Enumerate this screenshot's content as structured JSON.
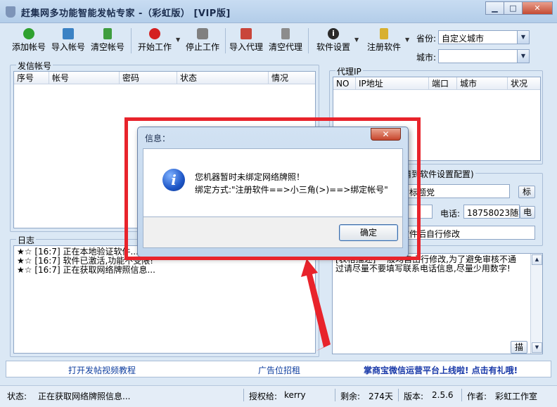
{
  "window": {
    "title": "赶集网多功能智能发帖专家 -（彩虹版） [VIP版]",
    "min_glyph": "▁",
    "max_glyph": "□",
    "close_glyph": "✕"
  },
  "toolbar": {
    "add_account": "添加帐号",
    "import_account": "导入帐号",
    "clear_account": "清空帐号",
    "start_work": "开始工作",
    "stop_work": "停止工作",
    "import_proxy": "导入代理",
    "clear_proxy": "清空代理",
    "software_settings": "软件设置",
    "register_software": "注册软件"
  },
  "location": {
    "province_label": "省份:",
    "province_value": "自定义城市",
    "city_label": "城市:",
    "city_value": ""
  },
  "accounts": {
    "group_title": "发信帐号",
    "columns": [
      "序号",
      "帐号",
      "密码",
      "状态",
      "情况"
    ]
  },
  "proxy": {
    "group_title": "代理IP",
    "columns": [
      "NO",
      "IP地址",
      "端口",
      "城市",
      "状况"
    ]
  },
  "settings": {
    "group_title": "请到软件设置配置)",
    "topic_text": "的标题党",
    "topic_btn": "标",
    "phone_label": "电话:",
    "phone_value": "18758023",
    "phone_random": "随机",
    "phone_btn": "电",
    "note": "软件后自行修改"
  },
  "content": {
    "text": "[表格描述] 一般均自由行修改,为了避免审核不通过请尽量不要填写联系电话信息,尽量少用数字!",
    "btn": "描"
  },
  "log": {
    "group_title": "日志",
    "lines": [
      "★☆ [16:7] 正在本地验证软件...",
      "★☆ [16:7] 软件已激活,功能不受限!",
      "★☆ [16:7] 正在获取网络牌照信息..."
    ]
  },
  "links": {
    "video": "打开发帖视频教程",
    "ad": "广告位招租",
    "promo": "掌商宝微信运营平台上线啦! 点击有礼哦!"
  },
  "status": {
    "state_label": "状态:",
    "state_value": "正在获取网络牌照信息...",
    "auth_label": "授权给:",
    "auth_value": "kerry",
    "remain_label": "剩余:",
    "remain_value": "274天",
    "version_label": "版本:",
    "version_value": "2.5.6",
    "author_label": "作者:",
    "author_value": "彩虹工作室"
  },
  "dialog": {
    "title": "信息：",
    "close": "✕",
    "line1": "您机器暂时未绑定网络牌照！",
    "line2": "绑定方式:\"注册软件==>小三角(>)==>绑定帐号\"",
    "ok": "确定"
  },
  "colors": {
    "highlight": "#e8232b",
    "link": "#1140a0"
  }
}
